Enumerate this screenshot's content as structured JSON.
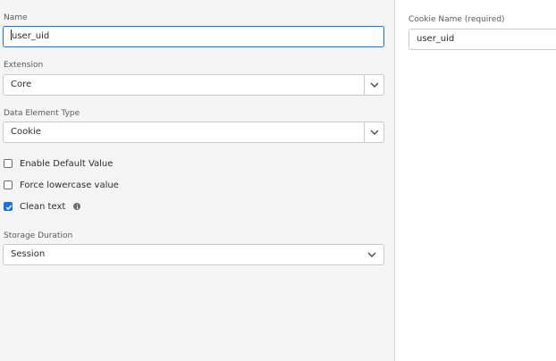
{
  "form": {
    "name_label": "Name",
    "name_value": "user_uid",
    "extension_label": "Extension",
    "extension_value": "Core",
    "type_label": "Data Element Type",
    "type_value": "Cookie",
    "checkboxes": [
      {
        "label": "Enable Default Value",
        "checked": false
      },
      {
        "label": "Force lowercase value",
        "checked": false
      },
      {
        "label": "Clean text",
        "checked": true
      }
    ],
    "storage_label": "Storage Duration",
    "storage_value": "Session"
  },
  "settings": {
    "cookie_name_label": "Cookie Name (required)",
    "cookie_name_value": "user_uid"
  },
  "colors": {
    "accent": "#1473e6",
    "panel_bg": "#f5f5f5",
    "border": "#cacaca"
  },
  "icons": {
    "dropdown": "chevron-down-icon",
    "checkmark": "checkmark-icon",
    "info": "info-icon"
  }
}
